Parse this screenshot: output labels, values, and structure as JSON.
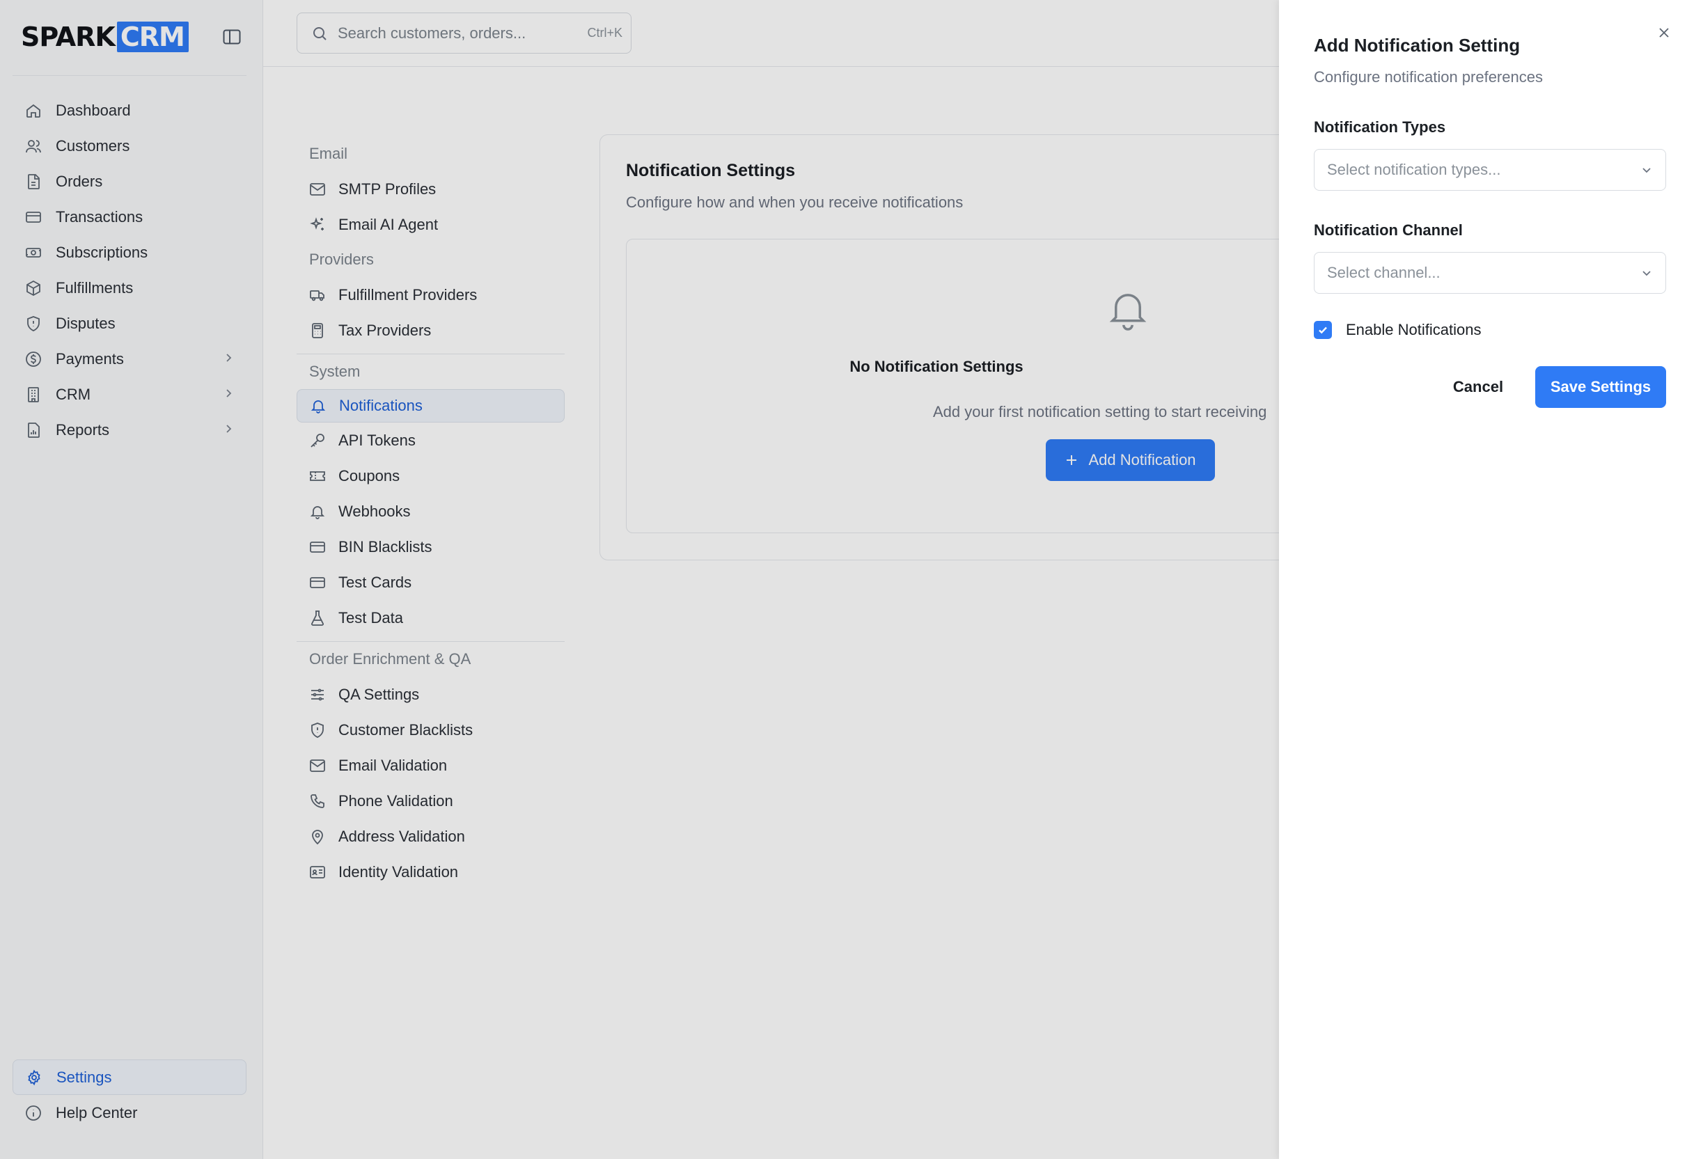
{
  "brand": {
    "name_a": "SPARK",
    "name_b": "CRM",
    "accent": "#2f7bf5"
  },
  "sidebar": {
    "collapse_icon": "sidebar-toggle-icon",
    "items": [
      {
        "label": "Dashboard",
        "icon": "home-icon"
      },
      {
        "label": "Customers",
        "icon": "users-icon"
      },
      {
        "label": "Orders",
        "icon": "file-icon"
      },
      {
        "label": "Transactions",
        "icon": "credit-card-icon"
      },
      {
        "label": "Subscriptions",
        "icon": "banknote-icon"
      },
      {
        "label": "Fulfillments",
        "icon": "package-icon"
      },
      {
        "label": "Disputes",
        "icon": "shield-icon"
      },
      {
        "label": "Payments",
        "icon": "dollar-circle-icon",
        "has_children": true
      },
      {
        "label": "CRM",
        "icon": "building-icon",
        "has_children": true
      },
      {
        "label": "Reports",
        "icon": "report-icon",
        "has_children": true
      }
    ],
    "bottom": [
      {
        "label": "Settings",
        "icon": "gear-icon",
        "active": true
      },
      {
        "label": "Help Center",
        "icon": "info-icon"
      }
    ]
  },
  "search": {
    "placeholder": "Search customers, orders...",
    "shortcut": "Ctrl+K"
  },
  "settings_nav": {
    "sections": [
      {
        "label": "Email",
        "items": [
          {
            "label": "SMTP Profiles",
            "icon": "mail-icon"
          },
          {
            "label": "Email AI Agent",
            "icon": "sparkles-icon"
          }
        ]
      },
      {
        "label": "Providers",
        "items": [
          {
            "label": "Fulfillment Providers",
            "icon": "truck-icon"
          },
          {
            "label": "Tax Providers",
            "icon": "calculator-icon"
          }
        ]
      },
      {
        "label": "System",
        "items": [
          {
            "label": "Notifications",
            "icon": "bell-icon",
            "active": true
          },
          {
            "label": "API Tokens",
            "icon": "key-icon"
          },
          {
            "label": "Coupons",
            "icon": "ticket-icon"
          },
          {
            "label": "Webhooks",
            "icon": "bell-icon"
          },
          {
            "label": "BIN Blacklists",
            "icon": "credit-card-icon"
          },
          {
            "label": "Test Cards",
            "icon": "credit-card-icon"
          },
          {
            "label": "Test Data",
            "icon": "flask-icon"
          }
        ]
      },
      {
        "label": "Order Enrichment & QA",
        "items": [
          {
            "label": "QA Settings",
            "icon": "sliders-icon"
          },
          {
            "label": "Customer Blacklists",
            "icon": "shield-icon"
          },
          {
            "label": "Email Validation",
            "icon": "mail-icon"
          },
          {
            "label": "Phone Validation",
            "icon": "phone-icon"
          },
          {
            "label": "Address Validation",
            "icon": "map-pin-icon"
          },
          {
            "label": "Identity Validation",
            "icon": "id-card-icon"
          }
        ]
      }
    ]
  },
  "main": {
    "title": "Notification Settings",
    "subtitle": "Configure how and when you receive notifications",
    "empty": {
      "title": "No Notification Settings",
      "description": "Add your first notification setting to start receiving",
      "button": "Add Notification"
    }
  },
  "drawer": {
    "title": "Add Notification Setting",
    "subtitle": "Configure notification preferences",
    "types_label": "Notification Types",
    "types_placeholder": "Select notification types...",
    "channel_label": "Notification Channel",
    "channel_placeholder": "Select channel...",
    "enable_label": "Enable Notifications",
    "enable_checked": true,
    "cancel": "Cancel",
    "save": "Save Settings"
  }
}
